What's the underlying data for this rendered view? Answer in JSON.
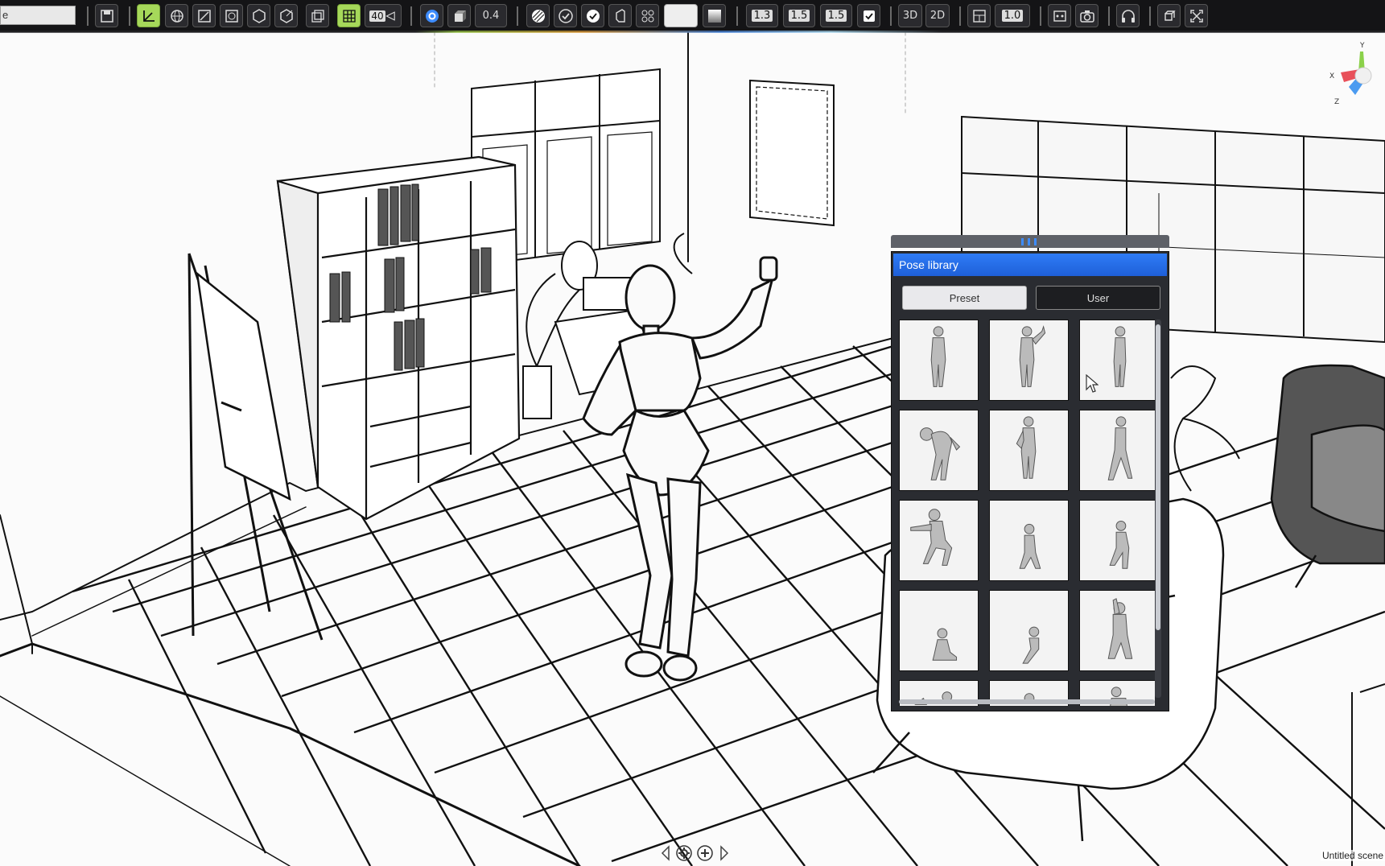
{
  "toolbar": {
    "scene_name_field": "e",
    "camera_angle_value": "40",
    "thickness_value": "0.4",
    "line_value_1": "1.3",
    "line_value_2": "1.5",
    "line_value_3": "1.5",
    "view_3d_label": "3D",
    "view_2d_label": "2D",
    "scale_value": "1.0"
  },
  "pose_library": {
    "title": "Pose library",
    "tab_preset": "Preset",
    "tab_user": "User",
    "active_tab": "Preset",
    "thumbnail_count_visible": 15
  },
  "gizmo": {
    "y_label": "Y",
    "x_label": "X",
    "z_label": "Z"
  },
  "status": {
    "scene_name": "Untitled scene"
  },
  "colors": {
    "toolbar_bg": "#141416",
    "toggle_active": "#a6d85a",
    "panel_title": "#2f7cf6",
    "panel_bg": "#2a2c31"
  }
}
